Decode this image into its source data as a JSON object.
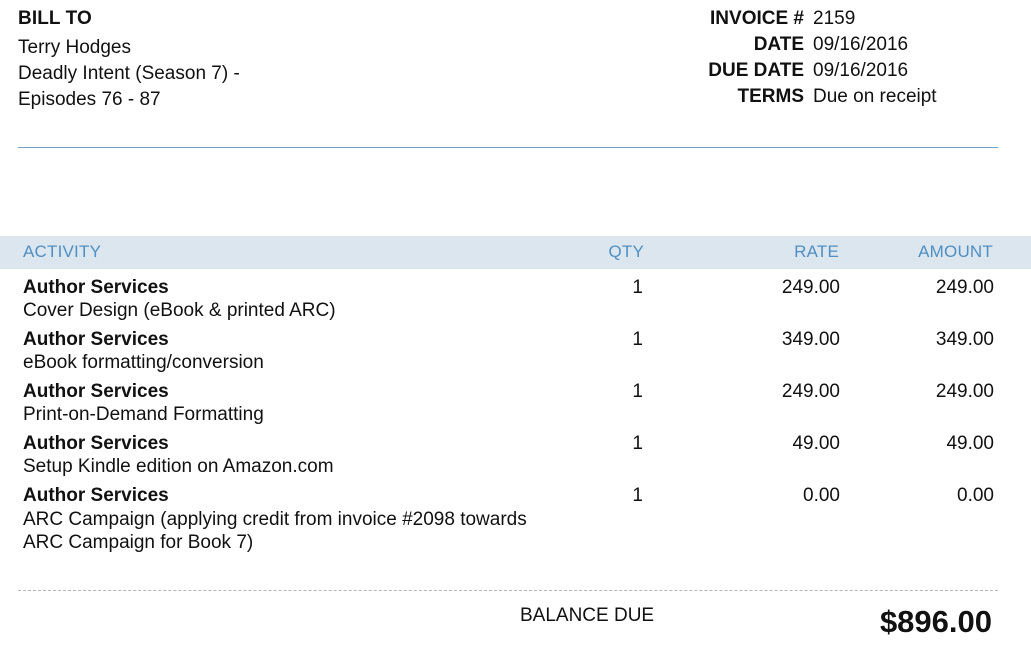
{
  "bill_to": {
    "label": "BILL TO",
    "lines": [
      "Terry Hodges",
      "Deadly Intent (Season 7) -",
      "Episodes 76 - 87"
    ]
  },
  "invoice": {
    "number_label": "INVOICE #",
    "number": "2159",
    "date_label": "DATE",
    "date": "09/16/2016",
    "due_date_label": "DUE DATE",
    "due_date": "09/16/2016",
    "terms_label": "TERMS",
    "terms": "Due on receipt"
  },
  "table": {
    "headers": {
      "activity": "ACTIVITY",
      "qty": "QTY",
      "rate": "RATE",
      "amount": "AMOUNT"
    },
    "rows": [
      {
        "title": "Author Services",
        "desc": "Cover Design (eBook & printed ARC)",
        "qty": "1",
        "rate": "249.00",
        "amount": "249.00"
      },
      {
        "title": "Author Services",
        "desc": "eBook formatting/conversion",
        "qty": "1",
        "rate": "349.00",
        "amount": "349.00"
      },
      {
        "title": "Author Services",
        "desc": "Print-on-Demand Formatting",
        "qty": "1",
        "rate": "249.00",
        "amount": "249.00"
      },
      {
        "title": "Author Services",
        "desc": "Setup Kindle edition on Amazon.com",
        "qty": "1",
        "rate": "49.00",
        "amount": "49.00"
      },
      {
        "title": "Author Services",
        "desc": "ARC Campaign (applying credit from invoice #2098 towards ARC Campaign for Book 7)",
        "qty": "1",
        "rate": "0.00",
        "amount": "0.00"
      }
    ]
  },
  "balance": {
    "label": "BALANCE DUE",
    "value": "$896.00"
  },
  "colors": {
    "header_band": "#dce6ef",
    "header_text": "#4f8fc3",
    "rule": "#6f9fc4"
  }
}
